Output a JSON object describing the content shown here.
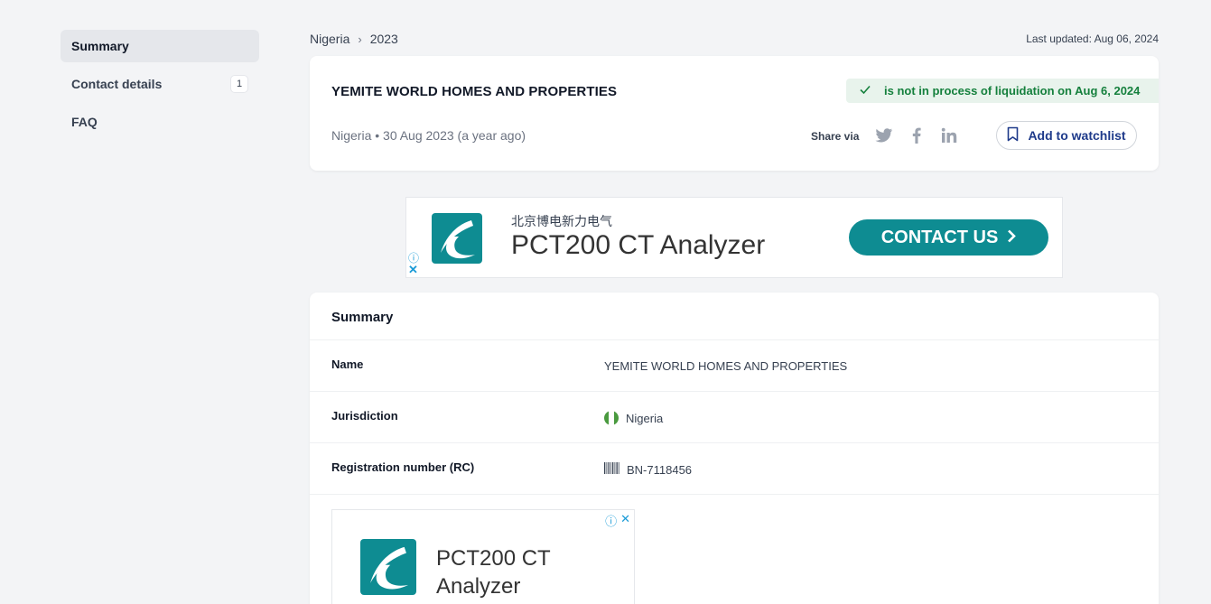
{
  "sidebar": {
    "items": [
      {
        "label": "Summary",
        "active": true
      },
      {
        "label": "Contact details",
        "badge": "1"
      },
      {
        "label": "FAQ"
      }
    ]
  },
  "breadcrumb": {
    "items": [
      "Nigeria",
      "2023"
    ],
    "separator": "›"
  },
  "last_updated": "Last updated: Aug 06, 2024",
  "header": {
    "company_name": "YEMITE WORLD HOMES AND PROPERTIES",
    "status_text": "is not in process of liquidation on Aug 6, 2024",
    "meta": "Nigeria • 30 Aug 2023 (a year ago)",
    "share_label": "Share via",
    "share_icons": [
      "twitter-icon",
      "facebook-icon",
      "linkedin-icon"
    ],
    "watchlist_label": "Add to watchlist"
  },
  "ad_banner": {
    "subtitle": "北京博电新力电气",
    "title": "PCT200 CT Analyzer",
    "cta": "CONTACT US",
    "info_glyph": "ⓘ",
    "close_glyph": "✕"
  },
  "summary": {
    "heading": "Summary",
    "rows": [
      {
        "label": "Name",
        "value": "YEMITE WORLD HOMES AND PROPERTIES"
      },
      {
        "label": "Jurisdiction",
        "value": "Nigeria"
      },
      {
        "label": "Registration number (RC)",
        "value": "BN-7118456"
      }
    ]
  },
  "ad_box": {
    "title": "PCT200 CT Analyzer"
  },
  "colors": {
    "accent_teal": "#0e8c92",
    "status_green": "#15803d",
    "link_blue": "#1e3a8a"
  }
}
